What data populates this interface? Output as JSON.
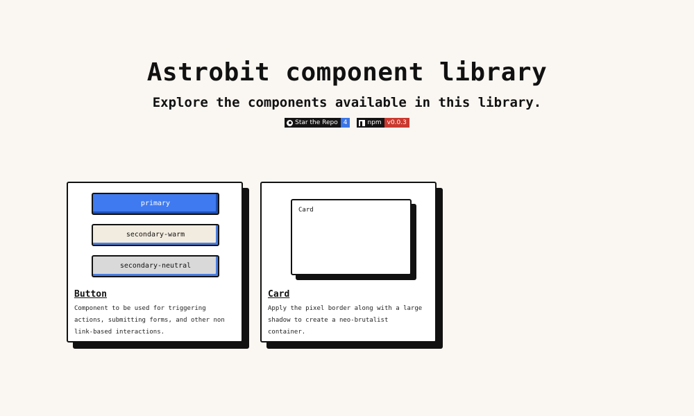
{
  "hero": {
    "title": "Astrobit component library",
    "subtitle": "Explore the components available in this library."
  },
  "badges": {
    "github": {
      "label": "Star the Repo",
      "value": "4",
      "icon": "github-icon",
      "value_color": "#3b76e6"
    },
    "npm": {
      "label": "npm",
      "value": "v0.0.3",
      "icon": "npm-icon",
      "value_color": "#c9392f"
    }
  },
  "panels": {
    "button": {
      "buttons": {
        "primary": "primary",
        "warm": "secondary-warm",
        "neutral": "secondary-neutral"
      },
      "title": "Button",
      "description": "Component to be used for triggering actions, submitting forms, and other non link-based interactions."
    },
    "card": {
      "demo_label": "Card",
      "title": "Card",
      "description": "Apply the pixel border along with a large shadow to create a neo-brutalist container."
    }
  },
  "colors": {
    "background": "#faf7f2",
    "primary": "#3f7af0",
    "warm": "#f2ebdf",
    "neutral": "#d9d9d9",
    "border": "#111111"
  }
}
